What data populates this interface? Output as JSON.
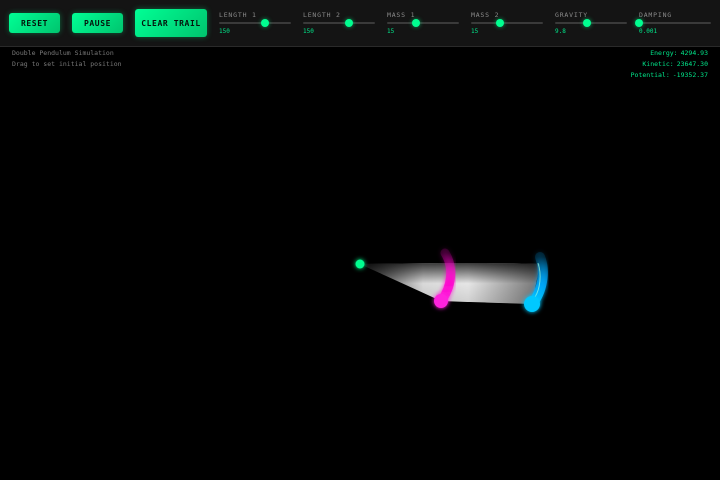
{
  "controls": {
    "reset_label": "RESET",
    "pause_label": "PAUSE",
    "clear_trail_label": "CLEAR TRAIL"
  },
  "sliders": [
    {
      "label": "LENGTH 1",
      "value": "150",
      "fraction": 0.64
    },
    {
      "label": "LENGTH 2",
      "value": "150",
      "fraction": 0.64
    },
    {
      "label": "MASS 1",
      "value": "15",
      "fraction": 0.4
    },
    {
      "label": "MASS 2",
      "value": "15",
      "fraction": 0.4
    },
    {
      "label": "GRAVITY",
      "value": "9.8",
      "fraction": 0.45
    },
    {
      "label": "DAMPING",
      "value": "0.001",
      "fraction": 0.0
    }
  ],
  "info": {
    "title": "Double Pendulum Simulation",
    "hint": "Drag to set initial position"
  },
  "stats": {
    "energy_label": "Energy:",
    "energy_value": "4294.93",
    "kinetic_label": "Kinetic:",
    "kinetic_value": "23647.30",
    "potential_label": "Potential:",
    "potential_value": "-19352.37"
  },
  "colors": {
    "accent": "#00ff90",
    "mass1": "#ff00cc",
    "mass2": "#00aaff",
    "background": "#000000",
    "toolbar": "#141414"
  }
}
